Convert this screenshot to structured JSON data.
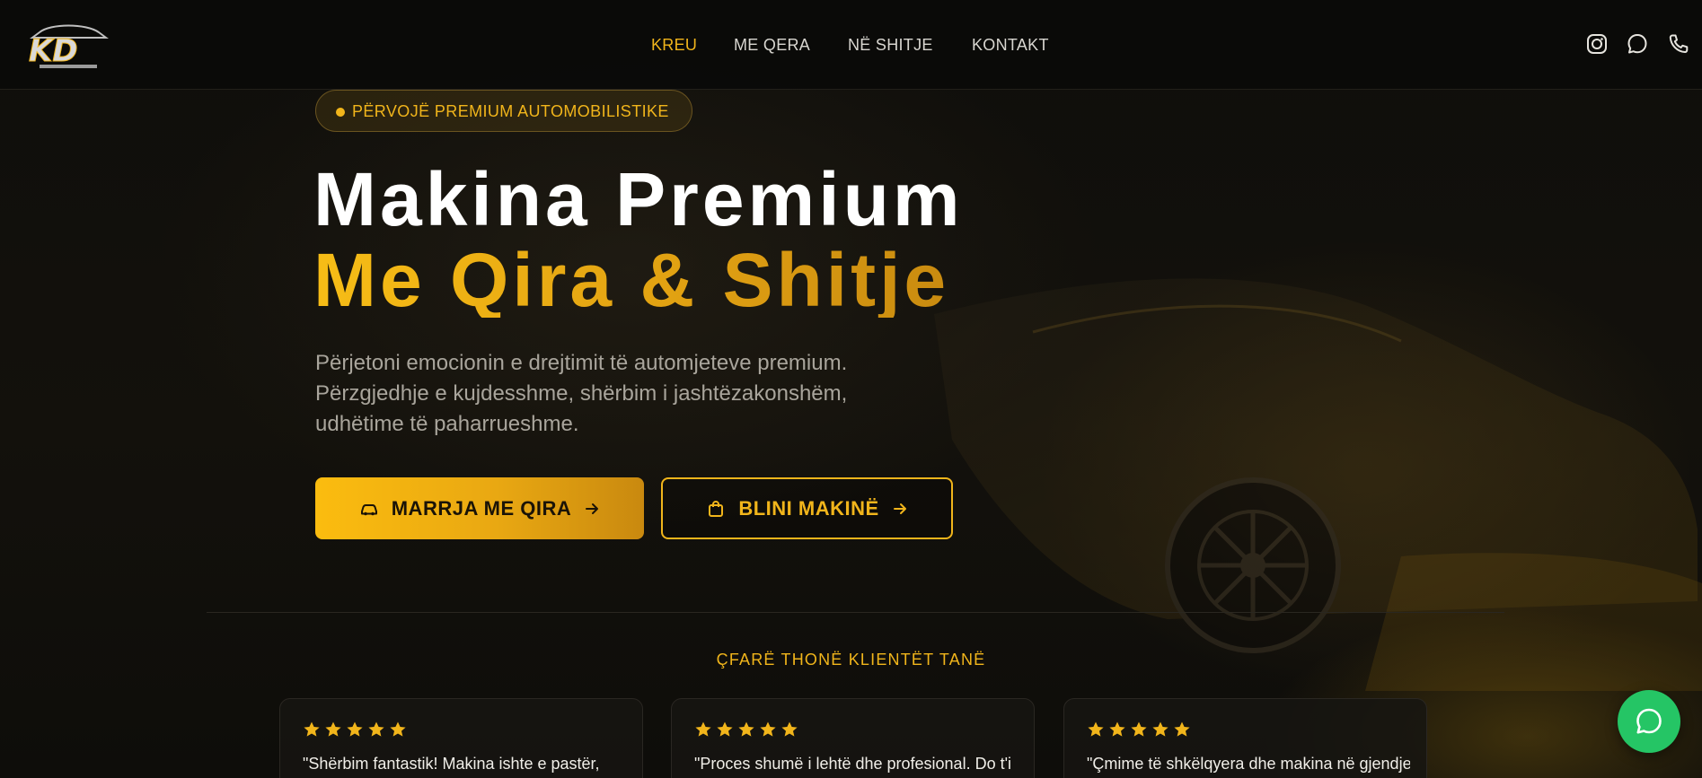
{
  "nav": {
    "items": [
      {
        "label": "KREU",
        "active": true
      },
      {
        "label": "ME QERA",
        "active": false
      },
      {
        "label": "NË SHITJE",
        "active": false
      },
      {
        "label": "KONTAKT",
        "active": false
      }
    ]
  },
  "social": {
    "icons": [
      "instagram-icon",
      "chat-icon",
      "phone-icon"
    ]
  },
  "hero": {
    "badge": "PËRVOJË PREMIUM AUTOMOBILISTIKE",
    "title_line1": "Makina Premium",
    "title_line2": "Me Qira & Shitje",
    "subtitle_lines": [
      "Përjetoni emocionin e drejtimit të automjeteve premium.",
      "Përzgjedhje e kujdesshme, shërbim i jashtëzakonshëm,",
      "udhëtime të paharrueshme."
    ],
    "rent_button": "MARRJA ME QIRA",
    "buy_button": "BLINI MAKINË"
  },
  "testimonials": {
    "title": "ÇFARË THONË KLIENTËT TANË",
    "cards": [
      {
        "rating": 5,
        "quote": "\"Shërbim fantastik! Makina ishte e pastër,"
      },
      {
        "rating": 5,
        "quote": "\"Proces shumë i lehtë dhe profesional. Do t'i"
      },
      {
        "rating": 5,
        "quote": "\"Çmime të shkëlqyera dhe makina në gjendje"
      }
    ]
  },
  "colors": {
    "accent": "#f1b51b",
    "background": "#0c0b09",
    "whatsapp": "#25c565"
  }
}
